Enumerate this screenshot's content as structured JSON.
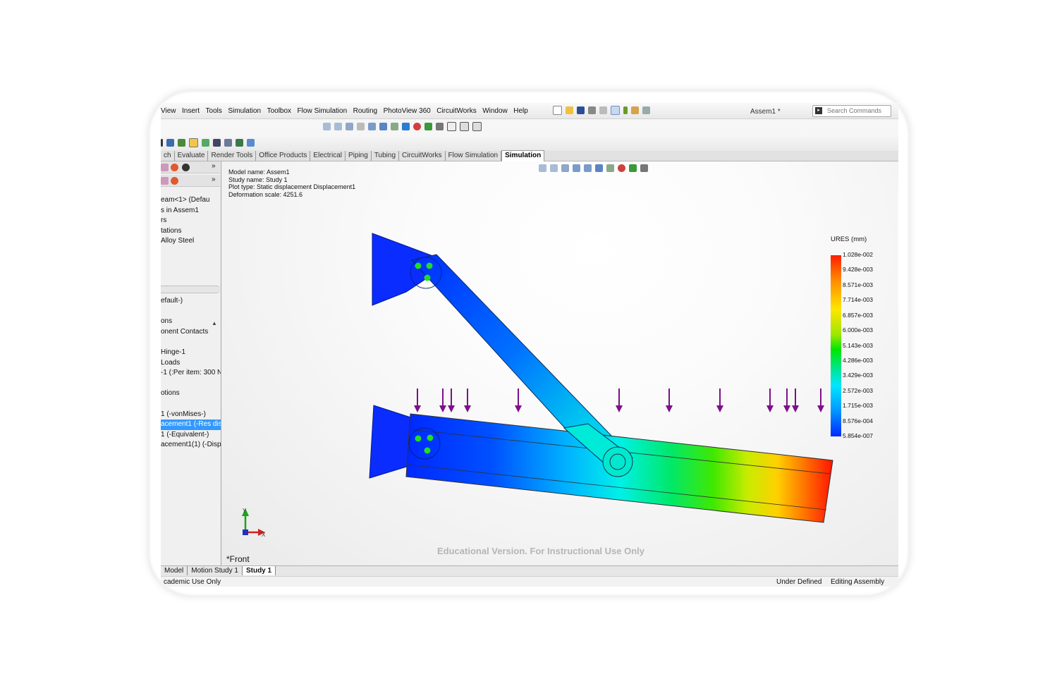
{
  "menu": [
    "View",
    "Insert",
    "Tools",
    "Simulation",
    "Toolbox",
    "Flow Simulation",
    "Routing",
    "PhotoView 360",
    "CircuitWorks",
    "Window",
    "Help"
  ],
  "document_title": "Assem1 *",
  "search_placeholder": "Search Commands",
  "command_tabs": [
    "Evaluate",
    "Render Tools",
    "Office Products",
    "Electrical",
    "Piping",
    "Tubing",
    "CircuitWorks",
    "Flow Simulation",
    "Simulation"
  ],
  "command_tab_first_partial": "ch",
  "active_command_tab": "Simulation",
  "feature_tree_top": [
    "eam<1> (Defau",
    "s in Assem1",
    "rs",
    "tations",
    "Alloy Steel"
  ],
  "study_tree": {
    "items": [
      "efault-)",
      "",
      "ons",
      "onent Contacts",
      "",
      "Hinge-1",
      "Loads",
      "-1 (:Per item: 300 N",
      "",
      "otions",
      "",
      "1 (-vonMises-)",
      "acement1 (-Res dis",
      "1 (-Equivalent-)",
      "acement1(1) (-Displ"
    ],
    "selected_index": 12
  },
  "plot_info": {
    "model_name": "Model name: Assem1",
    "study_name": "Study name: Study 1",
    "plot_type": "Plot type: Static displacement Displacement1",
    "deformation_scale": "Deformation scale: 4251.6"
  },
  "legend": {
    "title": "URES (mm)",
    "values": [
      "1.028e-002",
      "9.428e-003",
      "8.571e-003",
      "7.714e-003",
      "6.857e-003",
      "6.000e-003",
      "5.143e-003",
      "4.286e-003",
      "3.429e-003",
      "2.572e-003",
      "1.715e-003",
      "8.576e-004",
      "5.854e-007"
    ]
  },
  "watermark": "Educational Version. For Instructional Use Only",
  "view_name": "*Front",
  "axis_y_label": "Y",
  "axis_x_label": "X",
  "bottom_tabs": [
    "Model",
    "Motion Study 1",
    "Study 1"
  ],
  "active_bottom_tab": "Study 1",
  "status": {
    "left": "cademic Use Only",
    "center": "Under Defined",
    "right": "Editing Assembly"
  },
  "colors": {
    "load_arrow": "#7d0f8a",
    "fixture_dot": "#22dd22",
    "selection": "#3399ff",
    "low_displacement": "#0028ff",
    "high_displacement": "#ff1e00"
  }
}
